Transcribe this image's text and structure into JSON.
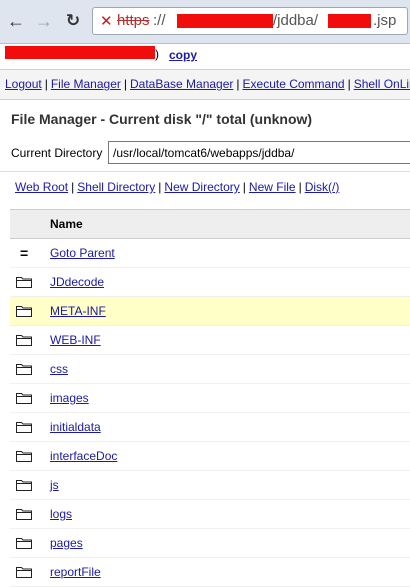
{
  "browser": {
    "url_scheme": "https",
    "url_sep": "://",
    "url_middle": "/jddba/",
    "url_end": ".jsp"
  },
  "header": {
    "paren": ")",
    "copy_label": "copy"
  },
  "menu": [
    "Logout",
    "File Manager",
    "DataBase Manager",
    "Execute Command",
    "Shell OnLine"
  ],
  "page": {
    "title": "File Manager - Current disk \"/\" total (unknow)",
    "current_dir_label": "Current Directory",
    "current_dir_value": "/usr/local/tomcat6/webapps/jddba/"
  },
  "toolbar": [
    "Web Root",
    "Shell Directory",
    "New Directory",
    "New File",
    "Disk(/)"
  ],
  "table": {
    "header_name": "Name",
    "parent_label": "Goto Parent",
    "folders": [
      "JDdecode",
      "META-INF",
      "WEB-INF",
      "css",
      "images",
      "initialdata",
      "interfaceDoc",
      "js",
      "logs",
      "pages",
      "reportFile"
    ],
    "highlighted": "META-INF"
  },
  "colors": {
    "link": "#1a1aa6",
    "highlight": "#ffffc7",
    "redaction": "#f20d0d"
  }
}
